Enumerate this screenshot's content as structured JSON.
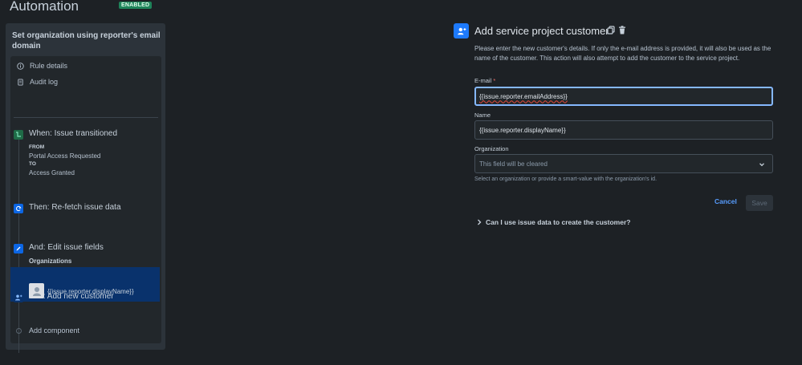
{
  "header": {
    "title": "Automation",
    "badge": "ENABLED"
  },
  "sidebar": {
    "rule_name": "Set organization using reporter's email domain",
    "links": [
      {
        "label": "Rule details",
        "icon": "info-icon"
      },
      {
        "label": "Audit log",
        "icon": "document-icon"
      }
    ],
    "steps": {
      "trigger": {
        "title": "When: Issue transitioned",
        "from_label": "FROM",
        "from_value": "Portal Access Requested",
        "to_label": "TO",
        "to_value": "Access Granted"
      },
      "refetch": {
        "title": "Then: Re-fetch issue data"
      },
      "edit": {
        "title": "And: Edit issue fields",
        "detail": "Organizations"
      },
      "add_customer": {
        "title": "And: Add new customer",
        "detail": "{{issue.reporter.displayName}}"
      }
    },
    "add_component": "Add component"
  },
  "panel": {
    "title": "Add service project customer",
    "description": "Please enter the new customer's details. If only the e-mail address is provided, it will also be used as the name of the customer. This action will also attempt to add the customer to the service project.",
    "email": {
      "label": "E-mail",
      "required_mark": "*",
      "value": "{{issue.reporter.emailAddress}}"
    },
    "name": {
      "label": "Name",
      "value": "{{issue.reporter.displayName}}"
    },
    "organization": {
      "label": "Organization",
      "placeholder": "This field will be cleared",
      "helper": "Select an organization or provide a smart-value with the organization's id."
    },
    "cancel_label": "Cancel",
    "save_label": "Save",
    "faq_label": "Can I use issue data to create the customer?"
  },
  "colors": {
    "background": "#1d2125",
    "accent": "#579dff",
    "badge": "#1f845a",
    "selected": "#09326c",
    "focus": "#85b8ff"
  }
}
